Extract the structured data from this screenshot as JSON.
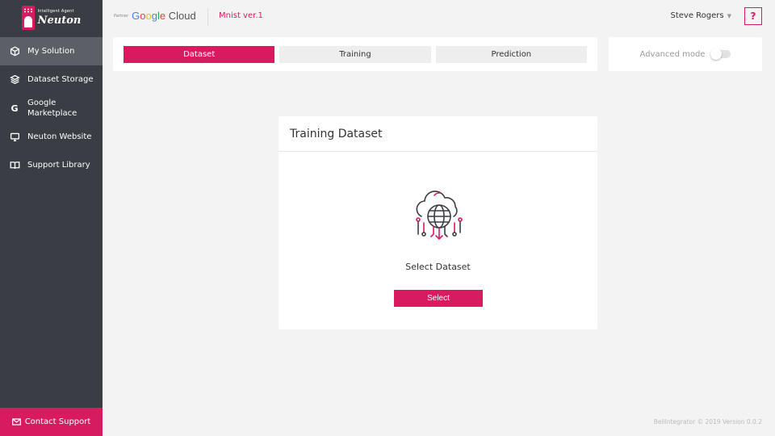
{
  "logo": {
    "tagline": "Intelligent Agent",
    "name": "Neuton"
  },
  "sidebar": {
    "items": [
      {
        "label": "My Solution",
        "icon": "cube-icon"
      },
      {
        "label": "Dataset Storage",
        "icon": "layers-icon"
      },
      {
        "label": "Google Marketplace",
        "line1": "Google",
        "line2": "Marketplace",
        "icon": "google-icon"
      },
      {
        "label": "Neuton Website",
        "icon": "monitor-icon"
      },
      {
        "label": "Support Library",
        "icon": "book-icon"
      }
    ],
    "contact_label": "Contact Support"
  },
  "header": {
    "partner_label": "Partner",
    "partner_brand": "Google Cloud",
    "project_name": "Mnist ver.1",
    "user_name": "Steve Rogers",
    "help_label": "?"
  },
  "steps": {
    "items": [
      {
        "label": "Dataset",
        "active": true
      },
      {
        "label": "Training",
        "active": false
      },
      {
        "label": "Prediction",
        "active": false
      }
    ]
  },
  "advanced": {
    "label": "Advanced mode",
    "enabled": false
  },
  "card": {
    "title": "Training Dataset",
    "prompt": "Select Dataset",
    "button_label": "Select"
  },
  "footer": {
    "text": "BellIntegrator © 2019 Version 0.0.2"
  },
  "colors": {
    "accent": "#d81b60",
    "sidebar": "#3a3d44",
    "sidebar_active": "#5c5f66",
    "background": "#f3f3f3"
  }
}
